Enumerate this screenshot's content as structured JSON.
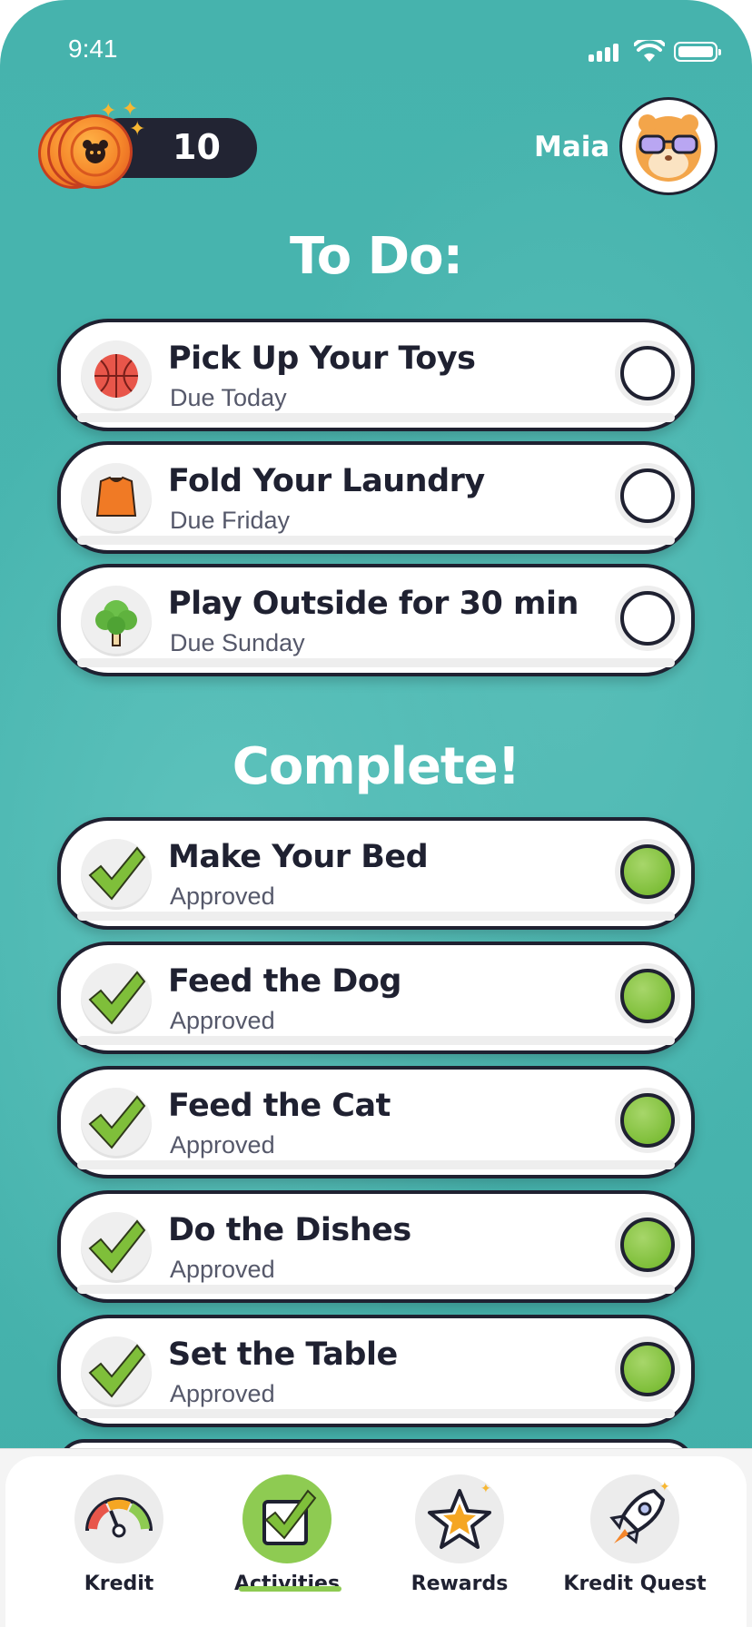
{
  "status_bar": {
    "time": "9:41"
  },
  "header": {
    "coin_count": "10",
    "user_name": "Maia"
  },
  "todo": {
    "title": "To Do:",
    "items": [
      {
        "title": "Pick Up Your Toys",
        "subtitle": "Due Today",
        "icon": "basketball-icon"
      },
      {
        "title": "Fold Your Laundry",
        "subtitle": "Due Friday",
        "icon": "shirt-icon"
      },
      {
        "title": "Play Outside for 30 min",
        "subtitle": "Due Sunday",
        "icon": "tree-icon"
      }
    ]
  },
  "complete": {
    "title": "Complete!",
    "items": [
      {
        "title": "Make Your Bed",
        "subtitle": "Approved",
        "icon": "checkmark-icon"
      },
      {
        "title": "Feed the Dog",
        "subtitle": "Approved",
        "icon": "checkmark-icon"
      },
      {
        "title": "Feed the Cat",
        "subtitle": "Approved",
        "icon": "checkmark-icon"
      },
      {
        "title": "Do the Dishes",
        "subtitle": "Approved",
        "icon": "checkmark-icon"
      },
      {
        "title": "Set the Table",
        "subtitle": "Approved",
        "icon": "checkmark-icon"
      }
    ]
  },
  "tabbar": {
    "tabs": [
      {
        "label": "Kredit",
        "icon": "gauge-icon",
        "active": false
      },
      {
        "label": "Activities",
        "icon": "checkbox-icon",
        "active": true
      },
      {
        "label": "Rewards",
        "icon": "star-icon",
        "active": false
      },
      {
        "label": "Kredit Quest",
        "icon": "rocket-icon",
        "active": false
      }
    ]
  },
  "colors": {
    "background": "#46b3ad",
    "card_border": "#1f2131",
    "complete_green": "#7fbf3a",
    "coin_orange": "#f5862a",
    "pill_dark": "#222433"
  }
}
